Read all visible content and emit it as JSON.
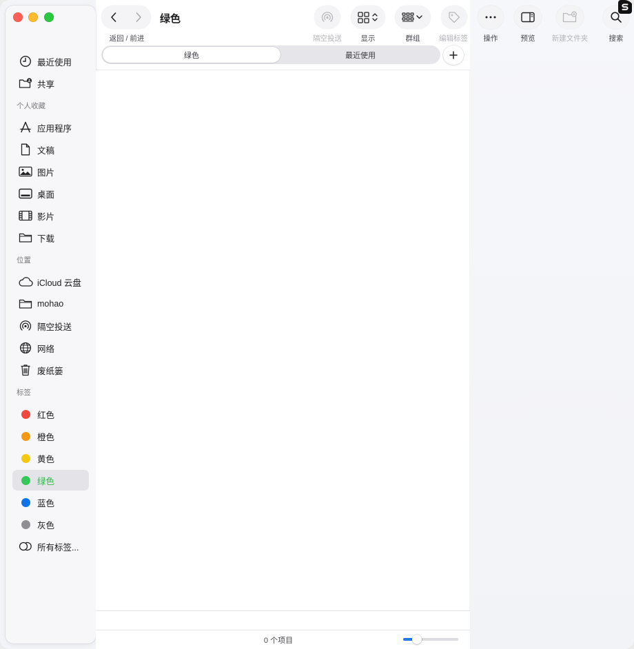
{
  "window": {
    "title": "绿色",
    "nav_caption": "返回 / 前进"
  },
  "toolbar": {
    "airdrop": "隔空投送",
    "view": "显示",
    "group": "群组",
    "edit_tags": "编辑标签",
    "actions": "操作",
    "preview": "预览",
    "new_folder": "新建文件夹",
    "search": "搜索"
  },
  "tabs": [
    {
      "label": "绿色",
      "active": true
    },
    {
      "label": "最近使用",
      "active": false
    }
  ],
  "sidebar": {
    "top_items": [
      {
        "label": "最近使用",
        "icon": "clock-icon"
      },
      {
        "label": "共享",
        "icon": "shared-folder-icon"
      }
    ],
    "favorites_title": "个人收藏",
    "favorites": [
      {
        "label": "应用程序",
        "icon": "apps-icon"
      },
      {
        "label": "文稿",
        "icon": "document-icon"
      },
      {
        "label": "图片",
        "icon": "photo-icon"
      },
      {
        "label": "桌面",
        "icon": "desktop-icon"
      },
      {
        "label": "影片",
        "icon": "film-icon"
      },
      {
        "label": "下载",
        "icon": "folder-icon"
      }
    ],
    "locations_title": "位置",
    "locations": [
      {
        "label": "iCloud 云盘",
        "icon": "cloud-icon"
      },
      {
        "label": "mohao",
        "icon": "folder-icon"
      },
      {
        "label": "隔空投送",
        "icon": "airdrop-icon"
      },
      {
        "label": "网络",
        "icon": "globe-icon"
      },
      {
        "label": "废纸篓",
        "icon": "trash-icon"
      }
    ],
    "tags_title": "标签",
    "tags": [
      {
        "label": "红色",
        "color": "#f0483e"
      },
      {
        "label": "橙色",
        "color": "#f39a12"
      },
      {
        "label": "黄色",
        "color": "#f5c90f"
      },
      {
        "label": "绿色",
        "color": "#35c759",
        "selected": true
      },
      {
        "label": "蓝色",
        "color": "#0a74e8"
      },
      {
        "label": "灰色",
        "color": "#8e8e93"
      }
    ],
    "all_tags": "所有标签..."
  },
  "status": {
    "item_count": "0 个项目",
    "zoom_level": 0.25
  },
  "colors": {
    "selected_tag_text": "#2fb84c",
    "accent": "#1d7cf2"
  }
}
